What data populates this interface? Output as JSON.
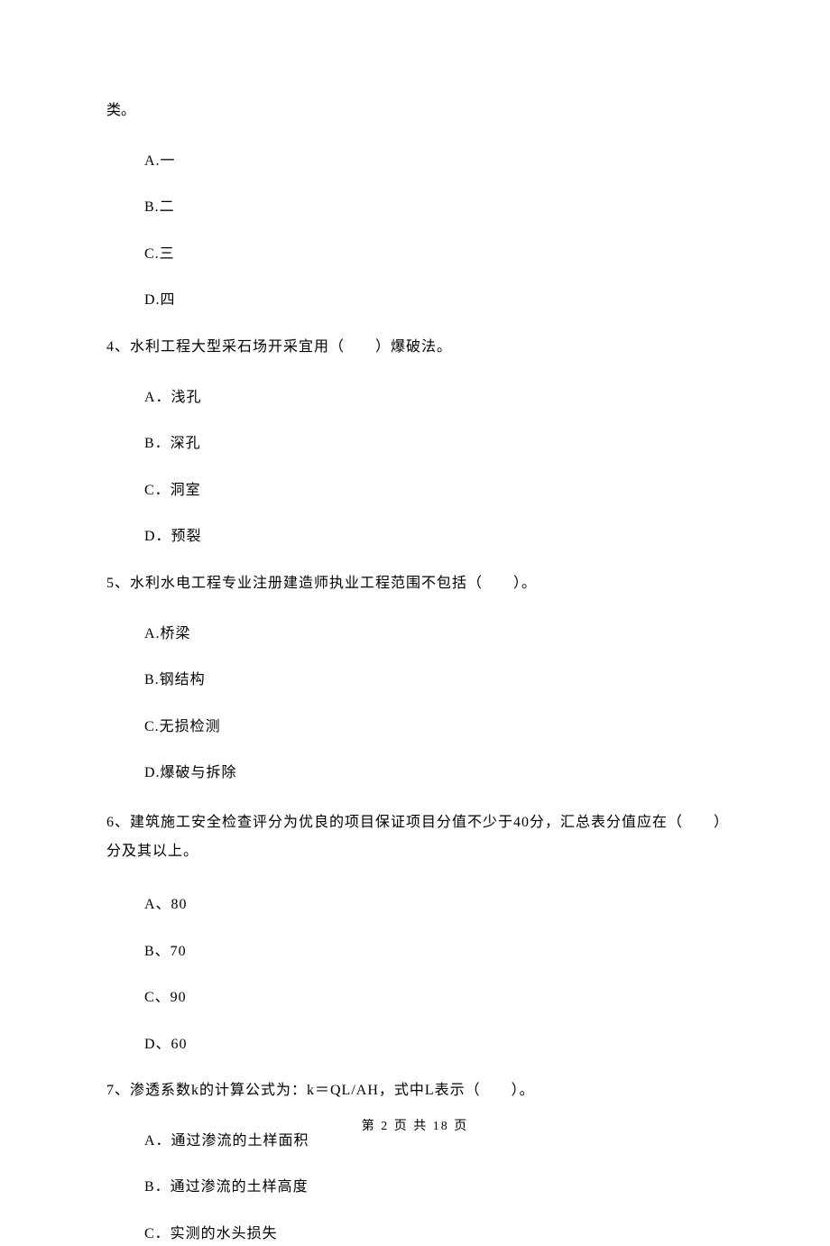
{
  "continuation": "类。",
  "q3": {
    "optA": "A.一",
    "optB": "B.二",
    "optC": "C.三",
    "optD": "D.四"
  },
  "q4": {
    "text": "4、水利工程大型采石场开采宜用（　　）爆破法。",
    "optA": "A．浅孔",
    "optB": "B．深孔",
    "optC": "C．洞室",
    "optD": "D．预裂"
  },
  "q5": {
    "text": "5、水利水电工程专业注册建造师执业工程范围不包括（　　）。",
    "optA": "A.桥梁",
    "optB": "B.钢结构",
    "optC": "C.无损检测",
    "optD": "D.爆破与拆除"
  },
  "q6": {
    "text": "6、建筑施工安全检查评分为优良的项目保证项目分值不少于40分，汇总表分值应在（　　）分及其以上。",
    "optA": "A、80",
    "optB": "B、70",
    "optC": "C、90",
    "optD": "D、60"
  },
  "q7": {
    "text": "7、渗透系数k的计算公式为：k＝QL/AH，式中L表示（　　）。",
    "optA": "A．通过渗流的土样面积",
    "optB": "B．通过渗流的土样高度",
    "optC": "C．实测的水头损失"
  },
  "footer": "第 2 页 共 18 页"
}
